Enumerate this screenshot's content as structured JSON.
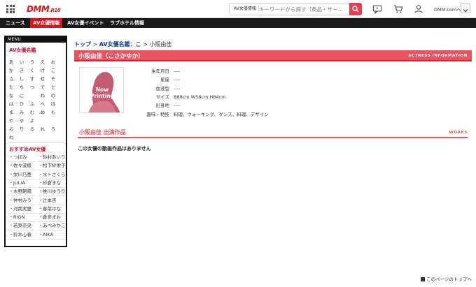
{
  "header": {
    "logo_main": "DMM",
    "logo_sub": ".R18",
    "search_category": "AV女優情報",
    "search_placeholder": "キーワードから探す（商品・サー...",
    "account_label": "DMM.comへ"
  },
  "nav": [
    "ニュース",
    "AV女優情報",
    "AV女優イベント",
    "ラブホテル情報"
  ],
  "sidebar": {
    "menu_label": "MENU",
    "index_title": "AV女優名鑑",
    "kana_rows": [
      [
        "あ",
        "い",
        "う",
        "え",
        "お"
      ],
      [
        "か",
        "き",
        "く",
        "け",
        "こ"
      ],
      [
        "さ",
        "し",
        "す",
        "せ",
        "そ"
      ],
      [
        "た",
        "ち",
        "つ",
        "て",
        "と"
      ],
      [
        "な",
        "に",
        "",
        "ね",
        "の"
      ],
      [
        "は",
        "ひ",
        "ふ",
        "へ",
        "ほ"
      ],
      [
        "ま",
        "み",
        "む",
        "め",
        "も"
      ],
      [
        "や",
        "ゆ",
        "よ",
        "",
        ""
      ],
      [
        "ら",
        "り",
        "る",
        "れ",
        "ろ"
      ],
      [
        "わ",
        "",
        "",
        "",
        ""
      ]
    ],
    "recommend_title": "おすすめAV女優",
    "recommend": [
      [
        "つぼみ",
        "鈴村あいり"
      ],
      [
        "佐々波綾",
        "松下紗栄子"
      ],
      [
        "栄川乃亜",
        "水トさくら"
      ],
      [
        "JULIA",
        "紗倉まな"
      ],
      [
        "水野朝陽",
        "推川ゆうり"
      ],
      [
        "仲村みう",
        "辻本杏"
      ],
      [
        "河南実里",
        "春菜はな"
      ],
      [
        "RION",
        "倉多まお"
      ],
      [
        "若菜奈央",
        "あべみかこ"
      ],
      [
        "鈴木心春",
        "AIKA"
      ]
    ]
  },
  "breadcrumb": {
    "top": "トップ",
    "index": "AV女優名鑑：こ",
    "current": "小阪由佳",
    "sep": ">"
  },
  "actress": {
    "name": "小阪由佳（こさかゆか）",
    "section_tag": "ACTRESS INFORMATION",
    "photo_text_1": "Now",
    "photo_text_2": "Printing",
    "profile": [
      {
        "label": "生年月日",
        "value": "----"
      },
      {
        "label": "星座",
        "value": "----"
      },
      {
        "label": "血液型",
        "value": "----"
      },
      {
        "label": "サイズ",
        "value": "B88cm W58cm H84cm"
      },
      {
        "label": "出身地",
        "value": "----"
      },
      {
        "label": "趣味・特技",
        "value": "料理、ウォーキング、ダンス、料理、デザイン"
      }
    ]
  },
  "works": {
    "title": "小阪由佳 出演作品",
    "tag": "WORKS",
    "empty_message": "この女優の動画作品はありません"
  },
  "footer": {
    "to_top": "このページのトップへ"
  },
  "colors": {
    "brand_red": "#d8141c",
    "accent_pink": "#e8535f",
    "nav_black": "#1a1a1a"
  }
}
